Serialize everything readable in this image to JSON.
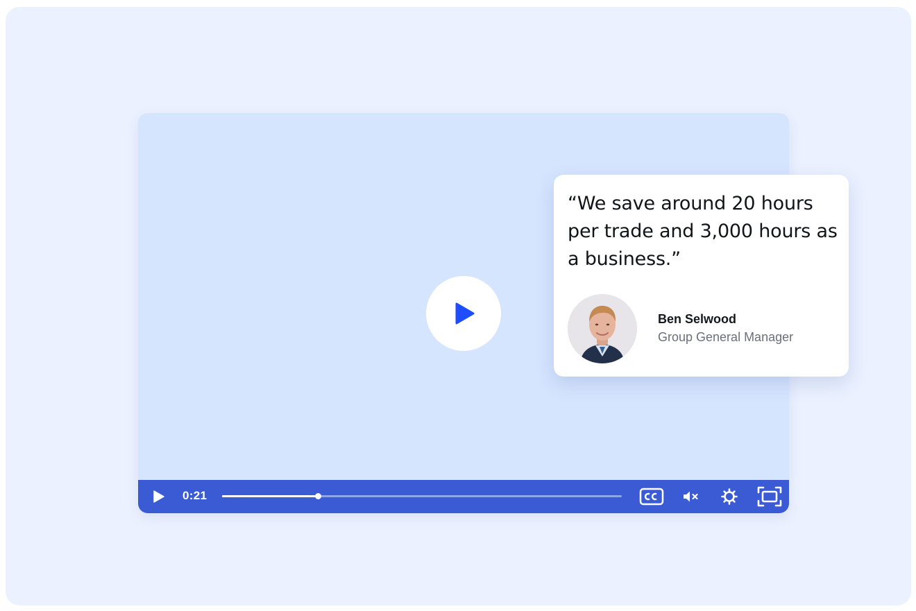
{
  "player": {
    "time": "0:21",
    "progress_fraction": 0.24,
    "icons": {
      "big_play": "play-icon",
      "play": "play-icon",
      "captions": "closed-captions-icon",
      "mute": "volume-muted-icon",
      "settings": "gear-icon",
      "fullscreen": "fullscreen-icon"
    }
  },
  "testimonial": {
    "quote": "“We save around 20 hours per trade and 3,000 hours as a business.”",
    "author_name": "Ben Selwood",
    "author_role": "Group General Manager",
    "avatar_icon": "avatar-photo"
  },
  "colors": {
    "background": "#ebf1ff",
    "video_area": "#d6e5fe",
    "control_bar": "#3a5bd4",
    "accent_play": "#1f4cff",
    "card": "#ffffff"
  }
}
